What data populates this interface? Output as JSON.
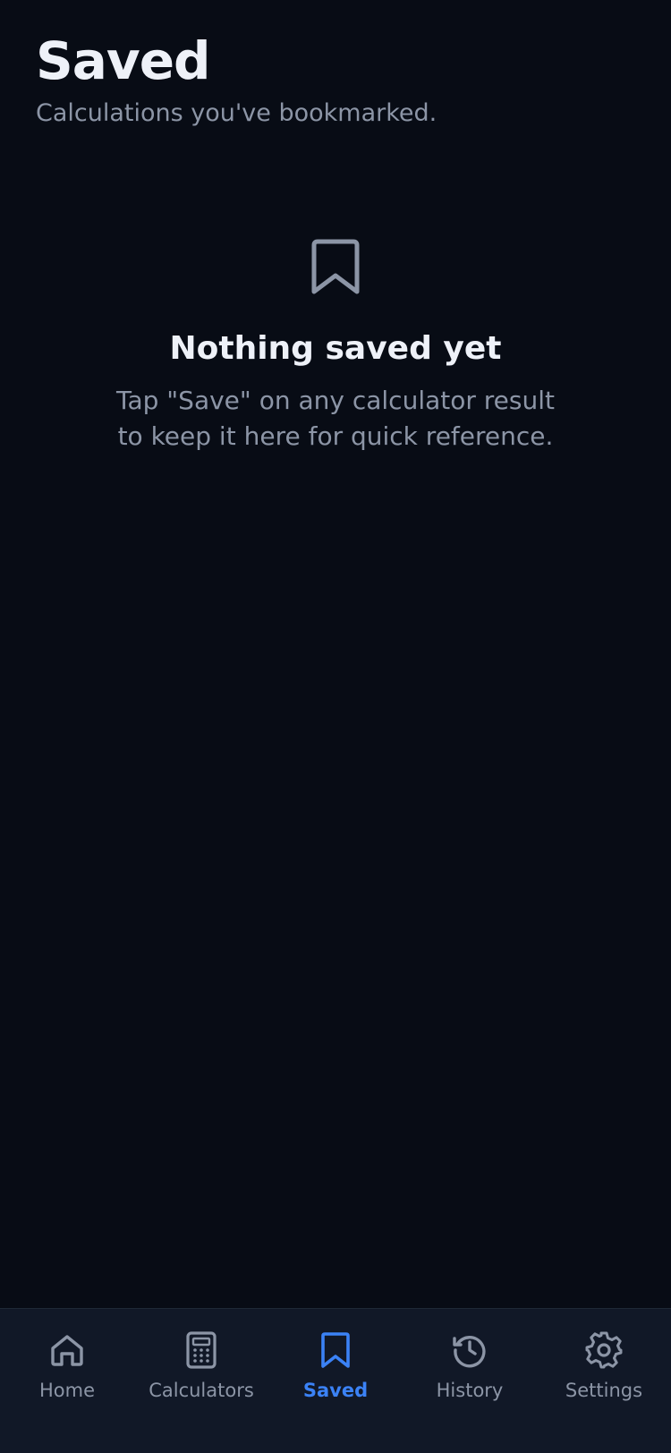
{
  "header": {
    "title": "Saved",
    "subtitle": "Calculations you've bookmarked."
  },
  "empty_state": {
    "icon": "bookmark-icon",
    "title": "Nothing saved yet",
    "body": "Tap \"Save\" on any calculator result to keep it here for quick reference."
  },
  "tabbar": {
    "active_color": "#3b82f6",
    "inactive_color": "#8c95a6",
    "tabs": [
      {
        "label": "Home",
        "icon": "home-icon",
        "active": false
      },
      {
        "label": "Calculators",
        "icon": "calculator-icon",
        "active": false
      },
      {
        "label": "Saved",
        "icon": "bookmark-icon",
        "active": true
      },
      {
        "label": "History",
        "icon": "history-icon",
        "active": false
      },
      {
        "label": "Settings",
        "icon": "gear-icon",
        "active": false
      }
    ]
  }
}
